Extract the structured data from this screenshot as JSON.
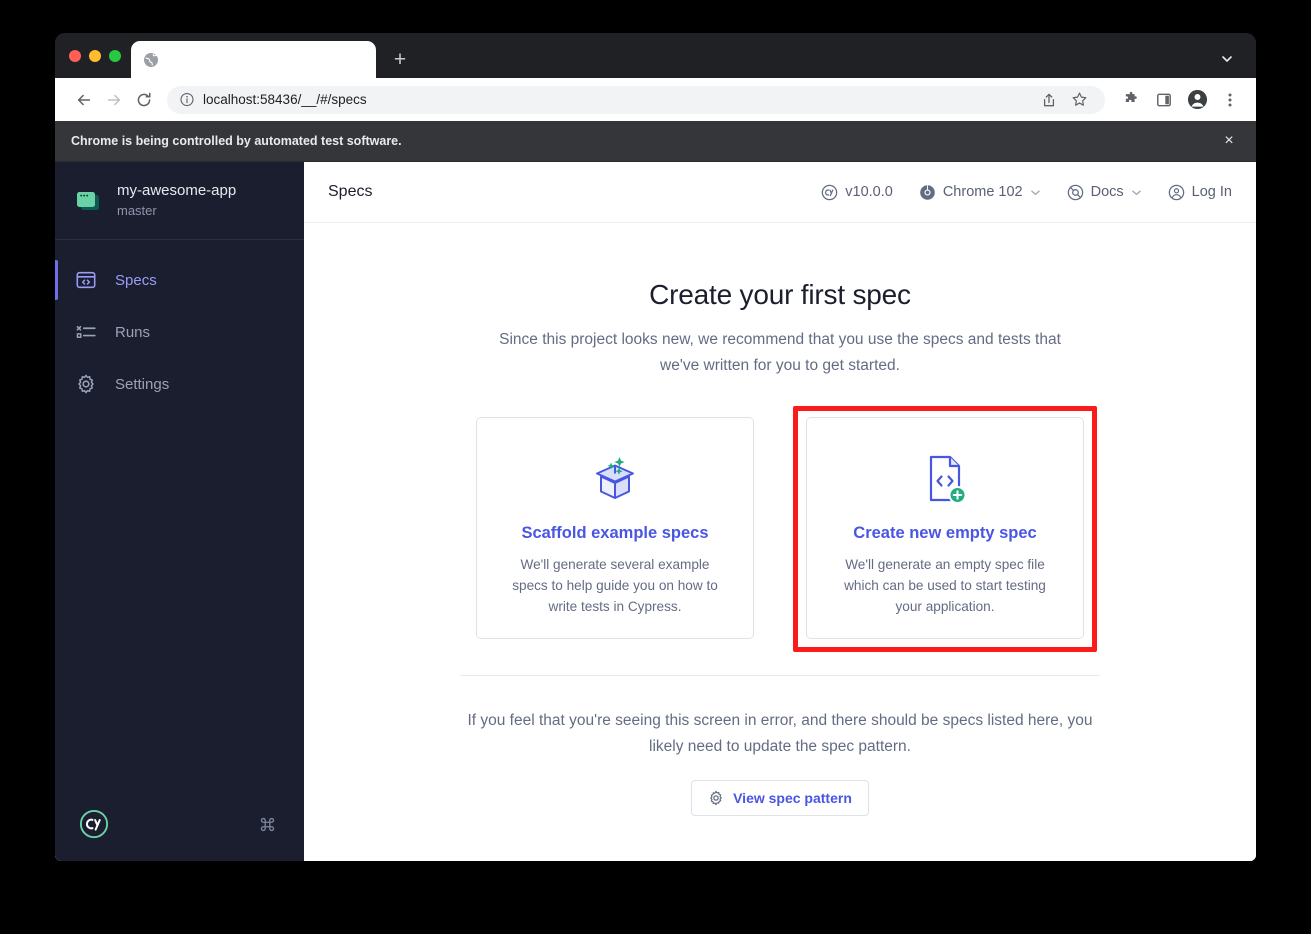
{
  "browser": {
    "tab": {
      "title": "",
      "favicon_icon": "globe-icon"
    },
    "new_tab_label": "+",
    "tab_search_icon": "chevron-down-icon",
    "toolbar": {
      "back_icon": "arrow-left-icon",
      "forward_icon": "arrow-right-icon",
      "reload_icon": "reload-icon",
      "info_icon": "info-circle-icon",
      "url": "localhost:58436/__/#/specs",
      "share_icon": "share-icon",
      "bookmark_icon": "star-icon",
      "extensions_icon": "puzzle-piece-icon",
      "side_panel_icon": "side-panel-icon",
      "profile_icon": "profile-avatar-icon",
      "menu_icon": "three-dots-menu-icon"
    },
    "infobar": {
      "message": "Chrome is being controlled by automated test software.",
      "close_label": "×"
    }
  },
  "sidebar": {
    "project": {
      "name": "my-awesome-app",
      "branch": "master",
      "icon": "project-window-icon"
    },
    "items": [
      {
        "label": "Specs",
        "icon": "specs-code-window-icon",
        "active": true
      },
      {
        "label": "Runs",
        "icon": "runs-list-icon",
        "active": false
      },
      {
        "label": "Settings",
        "icon": "gear-icon",
        "active": false
      }
    ],
    "footer": {
      "logo_icon": "cypress-cy-logo",
      "shortcut_icon": "command-key-icon",
      "shortcut_glyph": "⌘"
    }
  },
  "topbar": {
    "title": "Specs",
    "items": [
      {
        "label": "v10.0.0",
        "icon": "cypress-logo-icon",
        "caret": false
      },
      {
        "label": "Chrome 102",
        "icon": "chrome-browser-icon",
        "caret": true
      },
      {
        "label": "Docs",
        "icon": "docs-globe-icon",
        "caret": true
      },
      {
        "label": "Log In",
        "icon": "user-circle-icon",
        "caret": false
      }
    ]
  },
  "content": {
    "title": "Create your first spec",
    "subtitle": "Since this project looks new, we recommend that you use the specs and tests that we've written for you to get started.",
    "cards": [
      {
        "title": "Scaffold example specs",
        "description": "We'll generate several example specs to help guide you on how to write tests in Cypress.",
        "icon": "open-box-sparkles-icon",
        "highlighted": false
      },
      {
        "title": "Create new empty spec",
        "description": "We'll generate an empty spec file which can be used to start testing your application.",
        "icon": "new-code-file-icon",
        "highlighted": true
      }
    ],
    "footer_note": "If you feel that you're seeing this screen in error, and there should be specs listed here, you likely need to update the spec pattern.",
    "pattern_button": {
      "label": "View spec pattern",
      "icon": "gear-icon"
    }
  },
  "colors": {
    "accent_indigo": "#4956e3",
    "sidebar_bg": "#1b1e2e",
    "active_nav": "#9a9cf8",
    "highlight_red": "#fb1b1b",
    "brand_green": "#69d3a7"
  }
}
